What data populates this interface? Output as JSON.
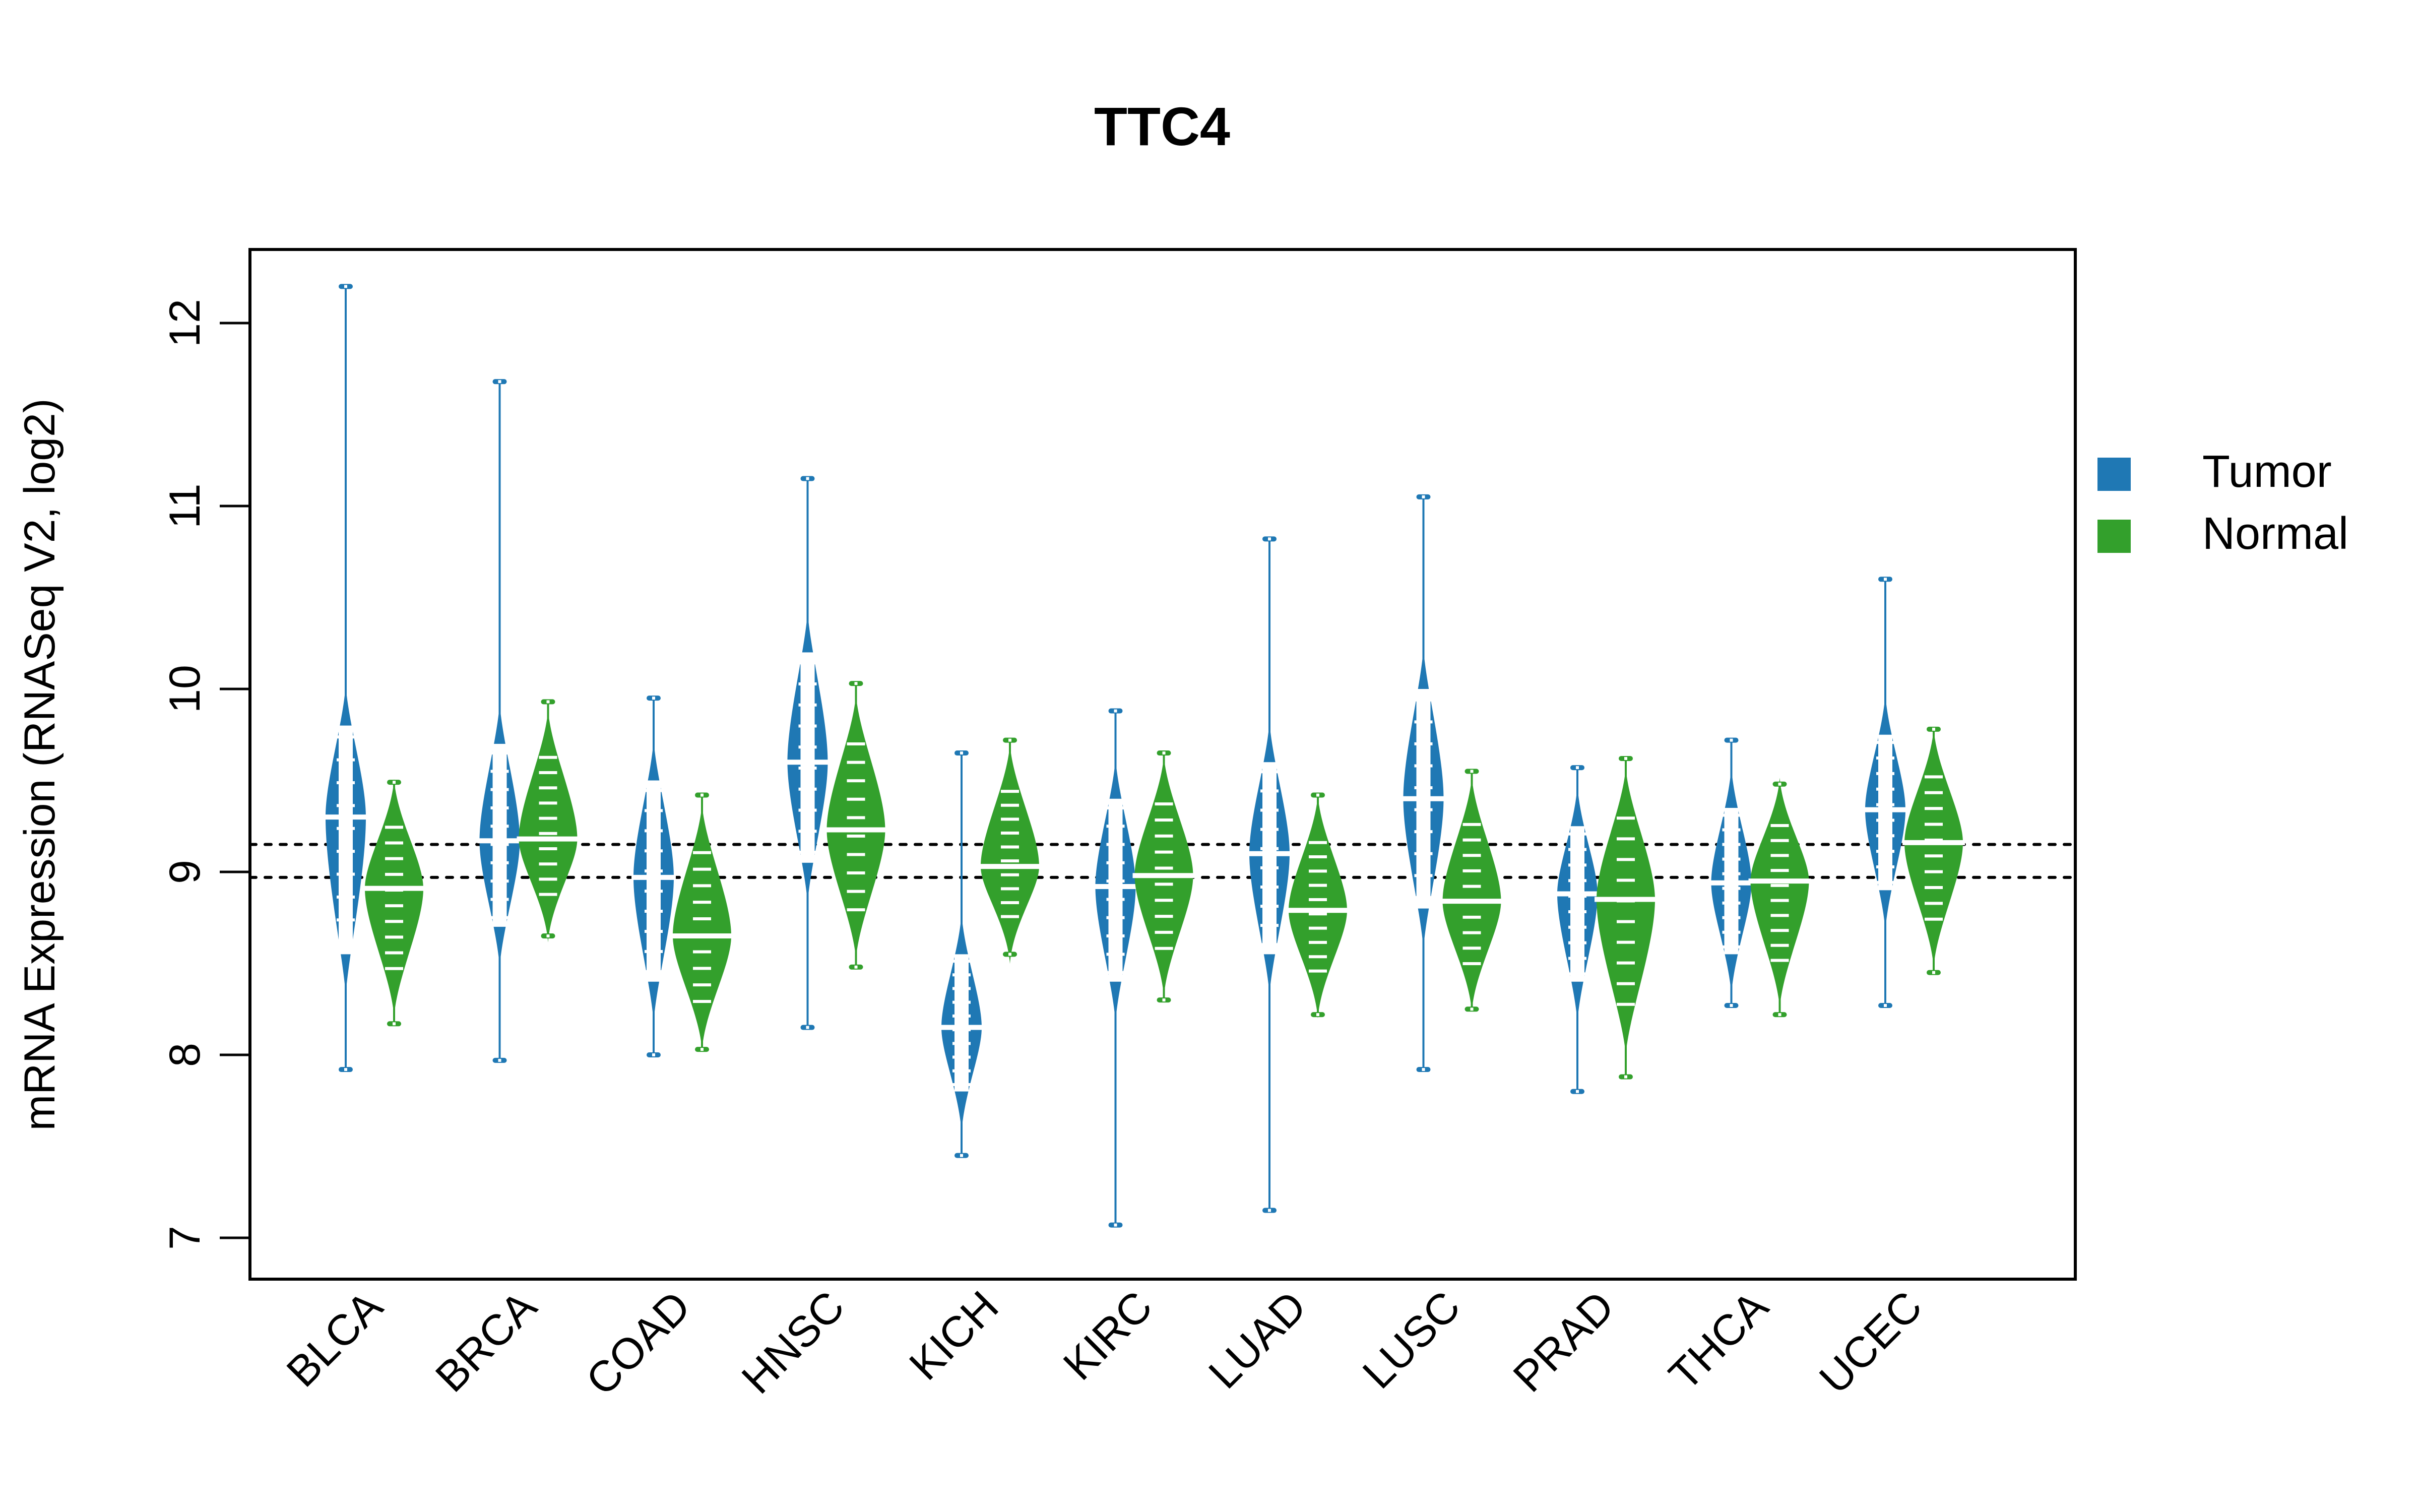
{
  "chart_data": {
    "type": "beanplot",
    "title": "TTC4",
    "xlabel": "",
    "ylabel": "mRNA Expression (RNASeq V2, log2)",
    "ylim": [
      6.86,
      12.42
    ],
    "yticks": [
      7,
      8,
      9,
      10,
      11,
      12
    ],
    "ytick_labels": [
      "7",
      "8",
      "9",
      "10",
      "11",
      "12"
    ],
    "categories": [
      "BLCA",
      "BRCA",
      "COAD",
      "HNSC",
      "KICH",
      "KIRC",
      "LUAD",
      "LUSC",
      "PRAD",
      "THCA",
      "UCEC"
    ],
    "reference_lines": [
      9.15,
      8.97
    ],
    "grid": false,
    "legend": {
      "position": "right",
      "entries": [
        "Tumor",
        "Normal"
      ]
    },
    "series": [
      {
        "name": "Tumor",
        "color": "#1f78b4",
        "median": [
          9.3,
          9.17,
          8.97,
          9.6,
          8.15,
          8.92,
          9.1,
          9.4,
          8.88,
          8.94,
          9.34
        ],
        "min": [
          7.92,
          7.97,
          8.0,
          8.15,
          7.45,
          7.07,
          7.15,
          7.92,
          7.8,
          8.27,
          8.27
        ],
        "max": [
          12.2,
          11.68,
          9.95,
          11.15,
          9.65,
          9.88,
          10.82,
          11.05,
          9.57,
          9.72,
          10.6
        ],
        "bulk_low": [
          8.55,
          8.7,
          8.4,
          9.05,
          7.8,
          8.4,
          8.55,
          8.8,
          8.4,
          8.55,
          8.9
        ],
        "bulk_high": [
          9.8,
          9.7,
          9.5,
          10.2,
          8.55,
          9.4,
          9.6,
          10.0,
          9.25,
          9.35,
          9.75
        ]
      },
      {
        "name": "Normal",
        "color": "#33a02c",
        "median": [
          8.91,
          9.18,
          8.65,
          9.23,
          9.03,
          8.98,
          8.79,
          8.84,
          8.85,
          8.95,
          9.16
        ],
        "min": [
          8.17,
          8.65,
          8.03,
          8.48,
          8.55,
          8.3,
          8.22,
          8.25,
          7.88,
          8.22,
          8.45
        ],
        "max": [
          9.49,
          9.93,
          9.42,
          10.03,
          9.72,
          9.65,
          9.42,
          9.55,
          9.62,
          9.48,
          9.78
        ]
      }
    ]
  }
}
